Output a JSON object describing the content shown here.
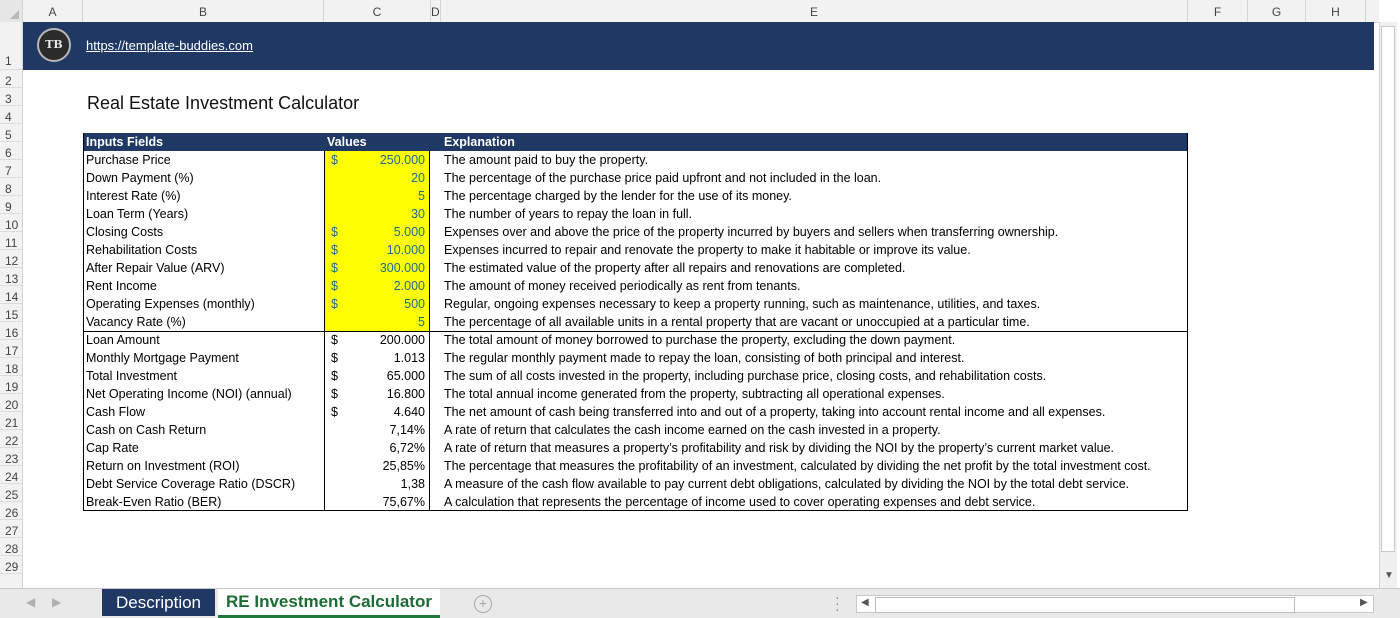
{
  "columns": [
    "A",
    "B",
    "C",
    "D",
    "E",
    "F",
    "G",
    "H"
  ],
  "rows": [
    "1",
    "2",
    "3",
    "4",
    "5",
    "6",
    "7",
    "8",
    "9",
    "10",
    "11",
    "12",
    "13",
    "14",
    "15",
    "16",
    "17",
    "18",
    "19",
    "20",
    "21",
    "22",
    "23",
    "24",
    "25",
    "26",
    "27",
    "28",
    "29"
  ],
  "banner": {
    "logo_text": "TB",
    "url": "https://template-buddies.com"
  },
  "title": "Real Estate Investment Calculator",
  "table": {
    "headers": {
      "field": "Inputs Fields",
      "value": "Values",
      "explanation": "Explanation"
    },
    "inputs": [
      {
        "label": "Purchase Price",
        "dollar": "$",
        "value": "250.000",
        "explanation": "The amount paid to buy the property."
      },
      {
        "label": "Down Payment (%)",
        "dollar": "",
        "value": "20",
        "explanation": "The percentage of the purchase price paid upfront and not included in the loan."
      },
      {
        "label": "Interest Rate (%)",
        "dollar": "",
        "value": "5",
        "explanation": "The percentage charged by the lender for the use of its money."
      },
      {
        "label": "Loan Term (Years)",
        "dollar": "",
        "value": "30",
        "explanation": "The number of years to repay the loan in full."
      },
      {
        "label": "Closing Costs",
        "dollar": "$",
        "value": "5.000",
        "explanation": "Expenses over and above the price of the property incurred by buyers and sellers when transferring ownership."
      },
      {
        "label": "Rehabilitation Costs",
        "dollar": "$",
        "value": "10.000",
        "explanation": "Expenses incurred to repair and renovate the property to make it habitable or improve its value."
      },
      {
        "label": "After Repair Value (ARV)",
        "dollar": "$",
        "value": "300.000",
        "explanation": "The estimated value of the property after all repairs and renovations are completed."
      },
      {
        "label": "Rent Income",
        "dollar": "$",
        "value": "2.000",
        "explanation": "The amount of money received periodically as rent from tenants."
      },
      {
        "label": "Operating Expenses (monthly)",
        "dollar": "$",
        "value": "500",
        "explanation": "Regular, ongoing expenses necessary to keep a property running, such as maintenance, utilities, and taxes."
      },
      {
        "label": "Vacancy Rate (%)",
        "dollar": "",
        "value": "5",
        "explanation": "The percentage of all available units in a rental property that are vacant or unoccupied at a particular time."
      }
    ],
    "outputs": [
      {
        "label": "Loan Amount",
        "dollar": "$",
        "value": "200.000",
        "explanation": "The total amount of money borrowed to purchase the property, excluding the down payment."
      },
      {
        "label": "Monthly Mortgage Payment",
        "dollar": "$",
        "value": "1.013",
        "explanation": "The regular monthly payment made to repay the loan, consisting of both principal and interest."
      },
      {
        "label": "Total Investment",
        "dollar": "$",
        "value": "65.000",
        "explanation": "The sum of all costs invested in the property, including purchase price, closing costs, and rehabilitation costs."
      },
      {
        "label": "Net Operating Income (NOI) (annual)",
        "dollar": "$",
        "value": "16.800",
        "explanation": "The total annual income generated from the property, subtracting all operational expenses."
      },
      {
        "label": "Cash Flow",
        "dollar": "$",
        "value": "4.640",
        "explanation": "The net amount of cash being transferred into and out of a property, taking into account rental income and all expenses."
      },
      {
        "label": "Cash on Cash Return",
        "dollar": "",
        "value": "7,14%",
        "explanation": "A rate of return that calculates the cash income earned on the cash invested in a property."
      },
      {
        "label": "Cap Rate",
        "dollar": "",
        "value": "6,72%",
        "explanation": "A rate of return that measures a property’s profitability and risk by dividing the NOI by the property’s current market value."
      },
      {
        "label": "Return on Investment (ROI)",
        "dollar": "",
        "value": "25,85%",
        "explanation": "The percentage that measures the profitability of an investment, calculated by dividing the net profit by the total investment cost."
      },
      {
        "label": "Debt Service Coverage Ratio (DSCR)",
        "dollar": "",
        "value": "1,38",
        "explanation": "A measure of the cash flow available to pay current debt obligations, calculated by dividing the NOI by the total debt service."
      },
      {
        "label": "Break-Even Ratio (BER)",
        "dollar": "",
        "value": "75,67%",
        "explanation": "A calculation that represents the percentage of income used to cover operating expenses and debt service."
      }
    ]
  },
  "tabs": [
    {
      "label": "Description",
      "active": false
    },
    {
      "label": "RE Investment Calculator",
      "active": true
    }
  ],
  "icons": {
    "prev_sheet": "chevron-left-icon",
    "next_sheet": "chevron-right-icon",
    "add_sheet": "plus-circle-icon",
    "scroll_left": "triangle-left-icon",
    "scroll_right": "triangle-right-icon",
    "scroll_up": "triangle-up-icon",
    "scroll_down": "triangle-down-icon"
  },
  "colors": {
    "banner": "#1f3864",
    "input_highlight": "#ffff00",
    "active_tab_text": "#1e6b36"
  }
}
